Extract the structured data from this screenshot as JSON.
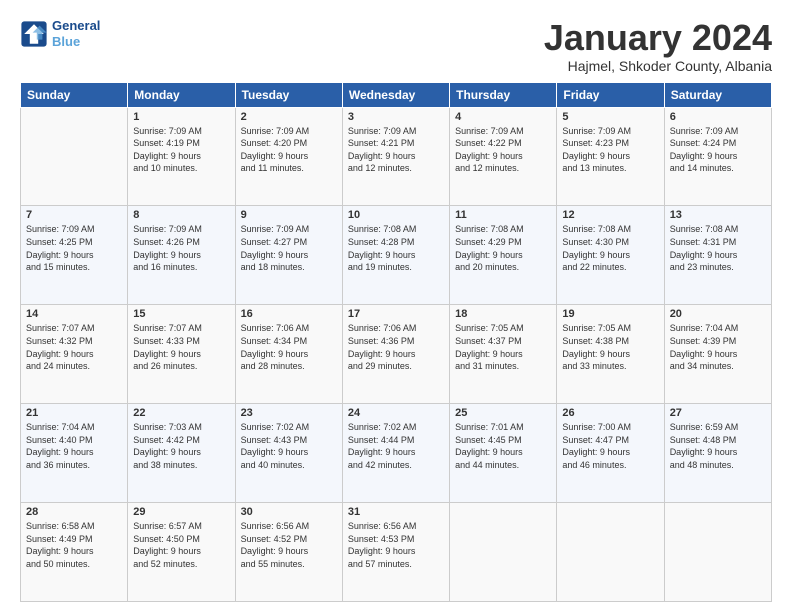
{
  "header": {
    "logo_line1": "General",
    "logo_line2": "Blue",
    "month_title": "January 2024",
    "location": "Hajmel, Shkoder County, Albania"
  },
  "days_of_week": [
    "Sunday",
    "Monday",
    "Tuesday",
    "Wednesday",
    "Thursday",
    "Friday",
    "Saturday"
  ],
  "weeks": [
    [
      {
        "day": "",
        "info": ""
      },
      {
        "day": "1",
        "info": "Sunrise: 7:09 AM\nSunset: 4:19 PM\nDaylight: 9 hours\nand 10 minutes."
      },
      {
        "day": "2",
        "info": "Sunrise: 7:09 AM\nSunset: 4:20 PM\nDaylight: 9 hours\nand 11 minutes."
      },
      {
        "day": "3",
        "info": "Sunrise: 7:09 AM\nSunset: 4:21 PM\nDaylight: 9 hours\nand 12 minutes."
      },
      {
        "day": "4",
        "info": "Sunrise: 7:09 AM\nSunset: 4:22 PM\nDaylight: 9 hours\nand 12 minutes."
      },
      {
        "day": "5",
        "info": "Sunrise: 7:09 AM\nSunset: 4:23 PM\nDaylight: 9 hours\nand 13 minutes."
      },
      {
        "day": "6",
        "info": "Sunrise: 7:09 AM\nSunset: 4:24 PM\nDaylight: 9 hours\nand 14 minutes."
      }
    ],
    [
      {
        "day": "7",
        "info": "Sunrise: 7:09 AM\nSunset: 4:25 PM\nDaylight: 9 hours\nand 15 minutes."
      },
      {
        "day": "8",
        "info": "Sunrise: 7:09 AM\nSunset: 4:26 PM\nDaylight: 9 hours\nand 16 minutes."
      },
      {
        "day": "9",
        "info": "Sunrise: 7:09 AM\nSunset: 4:27 PM\nDaylight: 9 hours\nand 18 minutes."
      },
      {
        "day": "10",
        "info": "Sunrise: 7:08 AM\nSunset: 4:28 PM\nDaylight: 9 hours\nand 19 minutes."
      },
      {
        "day": "11",
        "info": "Sunrise: 7:08 AM\nSunset: 4:29 PM\nDaylight: 9 hours\nand 20 minutes."
      },
      {
        "day": "12",
        "info": "Sunrise: 7:08 AM\nSunset: 4:30 PM\nDaylight: 9 hours\nand 22 minutes."
      },
      {
        "day": "13",
        "info": "Sunrise: 7:08 AM\nSunset: 4:31 PM\nDaylight: 9 hours\nand 23 minutes."
      }
    ],
    [
      {
        "day": "14",
        "info": "Sunrise: 7:07 AM\nSunset: 4:32 PM\nDaylight: 9 hours\nand 24 minutes."
      },
      {
        "day": "15",
        "info": "Sunrise: 7:07 AM\nSunset: 4:33 PM\nDaylight: 9 hours\nand 26 minutes."
      },
      {
        "day": "16",
        "info": "Sunrise: 7:06 AM\nSunset: 4:34 PM\nDaylight: 9 hours\nand 28 minutes."
      },
      {
        "day": "17",
        "info": "Sunrise: 7:06 AM\nSunset: 4:36 PM\nDaylight: 9 hours\nand 29 minutes."
      },
      {
        "day": "18",
        "info": "Sunrise: 7:05 AM\nSunset: 4:37 PM\nDaylight: 9 hours\nand 31 minutes."
      },
      {
        "day": "19",
        "info": "Sunrise: 7:05 AM\nSunset: 4:38 PM\nDaylight: 9 hours\nand 33 minutes."
      },
      {
        "day": "20",
        "info": "Sunrise: 7:04 AM\nSunset: 4:39 PM\nDaylight: 9 hours\nand 34 minutes."
      }
    ],
    [
      {
        "day": "21",
        "info": "Sunrise: 7:04 AM\nSunset: 4:40 PM\nDaylight: 9 hours\nand 36 minutes."
      },
      {
        "day": "22",
        "info": "Sunrise: 7:03 AM\nSunset: 4:42 PM\nDaylight: 9 hours\nand 38 minutes."
      },
      {
        "day": "23",
        "info": "Sunrise: 7:02 AM\nSunset: 4:43 PM\nDaylight: 9 hours\nand 40 minutes."
      },
      {
        "day": "24",
        "info": "Sunrise: 7:02 AM\nSunset: 4:44 PM\nDaylight: 9 hours\nand 42 minutes."
      },
      {
        "day": "25",
        "info": "Sunrise: 7:01 AM\nSunset: 4:45 PM\nDaylight: 9 hours\nand 44 minutes."
      },
      {
        "day": "26",
        "info": "Sunrise: 7:00 AM\nSunset: 4:47 PM\nDaylight: 9 hours\nand 46 minutes."
      },
      {
        "day": "27",
        "info": "Sunrise: 6:59 AM\nSunset: 4:48 PM\nDaylight: 9 hours\nand 48 minutes."
      }
    ],
    [
      {
        "day": "28",
        "info": "Sunrise: 6:58 AM\nSunset: 4:49 PM\nDaylight: 9 hours\nand 50 minutes."
      },
      {
        "day": "29",
        "info": "Sunrise: 6:57 AM\nSunset: 4:50 PM\nDaylight: 9 hours\nand 52 minutes."
      },
      {
        "day": "30",
        "info": "Sunrise: 6:56 AM\nSunset: 4:52 PM\nDaylight: 9 hours\nand 55 minutes."
      },
      {
        "day": "31",
        "info": "Sunrise: 6:56 AM\nSunset: 4:53 PM\nDaylight: 9 hours\nand 57 minutes."
      },
      {
        "day": "",
        "info": ""
      },
      {
        "day": "",
        "info": ""
      },
      {
        "day": "",
        "info": ""
      }
    ]
  ]
}
